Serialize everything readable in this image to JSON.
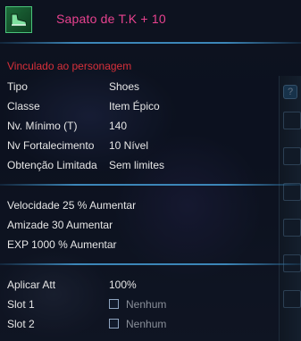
{
  "item": {
    "name": "Sapato de T.K + 10",
    "icon": "green-shoe-icon",
    "bound_text": "Vinculado ao personagem",
    "name_color": "#e8428f",
    "bound_color": "#d8303a"
  },
  "info": [
    {
      "label": "Tipo",
      "value": "Shoes"
    },
    {
      "label": "Classe",
      "value": "Item Épico"
    },
    {
      "label": "Nv. Mínimo (T)",
      "value": "140"
    },
    {
      "label": "Nv Fortalecimento",
      "value": "10 Nível"
    },
    {
      "label": "Obtenção Limitada",
      "value": "Sem limites"
    }
  ],
  "stats": [
    "Velocidade 25 % Aumentar",
    "Amizade 30 Aumentar",
    "EXP 1000 % Aumentar"
  ],
  "apply": {
    "label": "Aplicar Att",
    "value": "100%"
  },
  "slots": [
    {
      "label": "Slot 1",
      "value": "Nenhum"
    },
    {
      "label": "Slot 2",
      "value": "Nenhum"
    }
  ],
  "side_panel": {
    "help_label": "?"
  }
}
